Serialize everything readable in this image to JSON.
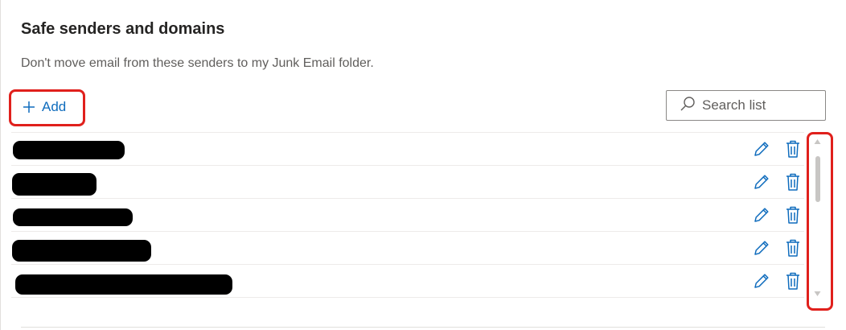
{
  "section": {
    "title": "Safe senders and domains",
    "description": "Don't move email from these senders to my Junk Email folder."
  },
  "toolbar": {
    "add_label": "Add",
    "add_icon": "plus-icon",
    "search_placeholder": "Search list",
    "search_icon": "search-icon"
  },
  "list": {
    "items": [
      {
        "redacted": true
      },
      {
        "redacted": true
      },
      {
        "redacted": true
      },
      {
        "redacted": true
      },
      {
        "redacted": true
      }
    ],
    "row_actions": [
      "pencil-icon",
      "trash-icon"
    ]
  },
  "colors": {
    "accent": "#0f6cbd",
    "highlight": "#e0201c",
    "redaction": "#000000"
  }
}
